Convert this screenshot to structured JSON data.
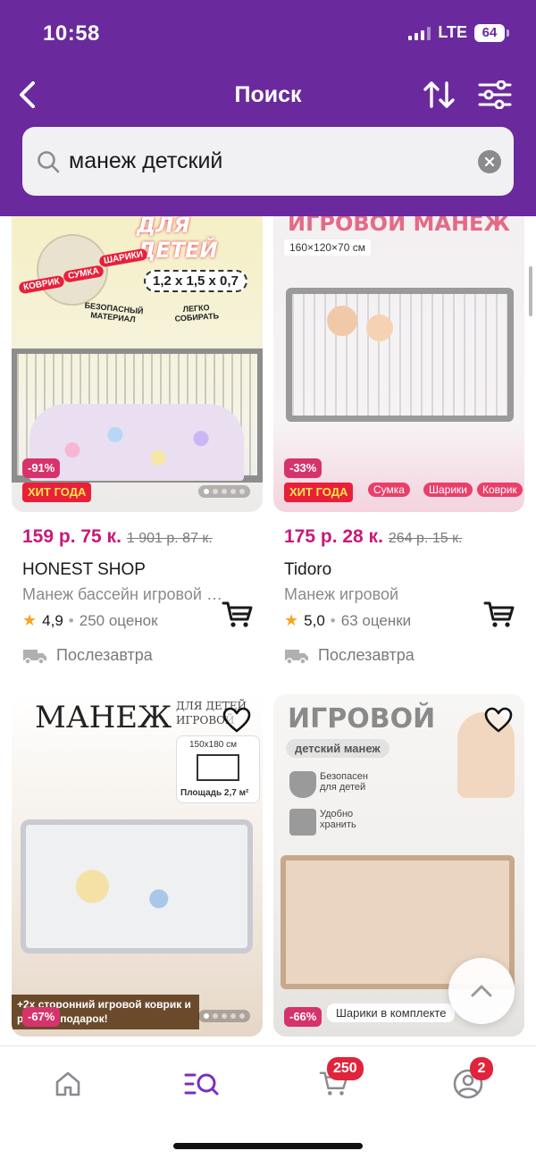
{
  "status_bar": {
    "time": "10:58",
    "network": "LTE",
    "battery": "64"
  },
  "header": {
    "title": "Поиск"
  },
  "search": {
    "value": "манеж детский"
  },
  "products": [
    {
      "image_texts": [
        "ДЛЯ ДЕТЕЙ",
        "1,2 x 1,5 x 0,7",
        "КОВРИК",
        "СУМКА",
        "ШАРИКИ",
        "БЕЗОПАСНЫЙ МАТЕРИАЛ",
        "ЛЕГКО СОБИРАТЬ"
      ],
      "discount": "-91%",
      "hit_badge": "ХИТ ГОДА",
      "price": "159 р.  75 к.",
      "old_price": "1 901 р.  87 к.",
      "shop": "HONEST SHOP",
      "name": "Манеж бассейн игровой для детей",
      "rating": "4,9",
      "reviews": "250 оценок",
      "delivery": "Послезавтра"
    },
    {
      "image_texts": [
        "ИГРОВОЙ МАНЕЖ",
        "160×120×70 см",
        "Сумка",
        "Шарики",
        "Коврик"
      ],
      "discount": "-33%",
      "hit_badge": "ХИТ ГОДА",
      "price": "175 р.  28 к.",
      "old_price": "264 р.  15 к.",
      "shop": "Tidoro",
      "name": "Манеж игровой",
      "rating": "5,0",
      "reviews": "63 оценки",
      "delivery": "Послезавтра"
    },
    {
      "image_texts": [
        "МАНЕЖ",
        "ДЛЯ ДЕТЕЙ",
        "ИГРОВОЙ",
        "150x180 см",
        "Площадь 2,7 м²",
        "+2х сторонний игровой коврик и ручки в подарок!"
      ],
      "discount": "-67%"
    },
    {
      "image_texts": [
        "ИГРОВОЙ",
        "детский манеж",
        "Безопасен для детей",
        "Удобно хранить",
        "Шарики в комплекте"
      ],
      "discount": "-66%"
    }
  ],
  "tabbar": {
    "cart_badge": "250",
    "profile_badge": "2"
  },
  "colors": {
    "brand": "#6a2a9d",
    "price": "#c8197a",
    "badge": "#e0243d"
  }
}
